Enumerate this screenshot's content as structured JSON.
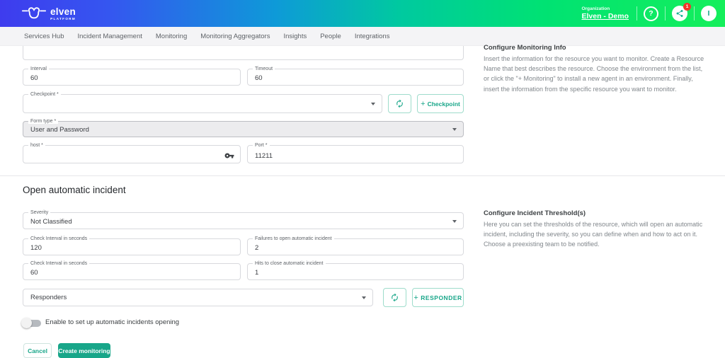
{
  "colors": {
    "accent": "#18a689",
    "header_gradient_start": "#3e3cee",
    "header_gradient_end": "#15ef5b",
    "badge": "#f1352b",
    "nav_bg": "#f4f4f6"
  },
  "header": {
    "brand": "elven",
    "brand_sub": "PLATFORM",
    "org_label": "Organization",
    "org_value": "Elven - Demo",
    "badge_count": "1",
    "avatar_initial": "I"
  },
  "nav": {
    "items": [
      {
        "label": "Services Hub"
      },
      {
        "label": "Incident Management"
      },
      {
        "label": "Monitoring"
      },
      {
        "label": "Monitoring Aggregators"
      },
      {
        "label": "Insights"
      },
      {
        "label": "People"
      },
      {
        "label": "Integrations"
      }
    ]
  },
  "form": {
    "interval": {
      "label": "Interval",
      "value": "60"
    },
    "timeout": {
      "label": "Timeout",
      "value": "60"
    },
    "checkpoint": {
      "label": "Checkpoint *",
      "value": ""
    },
    "checkpoint_add": "Checkpoint",
    "form_type": {
      "label": "Form type *",
      "value": "User and Password"
    },
    "host": {
      "label": "host *",
      "value": ""
    },
    "port": {
      "label": "Port *",
      "value": "11211"
    },
    "incident_title": "Open automatic incident",
    "severity": {
      "label": "Severity",
      "value": "Not Classified"
    },
    "check_open": {
      "label": "Check Interval in seconds",
      "value": "120"
    },
    "failures_open": {
      "label": "Failures to open automatic incident",
      "value": "2"
    },
    "check_close": {
      "label": "Check Interval in seconds",
      "value": "60"
    },
    "hits_close": {
      "label": "Hits to close automatic incident",
      "value": "1"
    },
    "responders": {
      "label": "Responders"
    },
    "responder_add": "RESPONDER",
    "toggle_label": "Enable to set up automatic incidents opening",
    "cancel": "Cancel",
    "create": "Create monitoring"
  },
  "help": {
    "block1_title": "Configure Monitoring Info",
    "block1_body": "Insert the information for the resource you want to monitor. Create a Resource Name that best describes the resource. Choose the environment from the list, or click the \"+ Monitoring\" to install a new agent in an environment. Finally, insert the information from the specific resource you want to monitor.",
    "block2_title": "Configure Incident Threshold(s)",
    "block2_body": "Here you can set the thresholds of the resource, which will open an automatic incident, including the severity, so you can define when and how to act on it. Choose a preexisting team to be notified."
  },
  "icons": {
    "help": "?",
    "plus": "+"
  }
}
